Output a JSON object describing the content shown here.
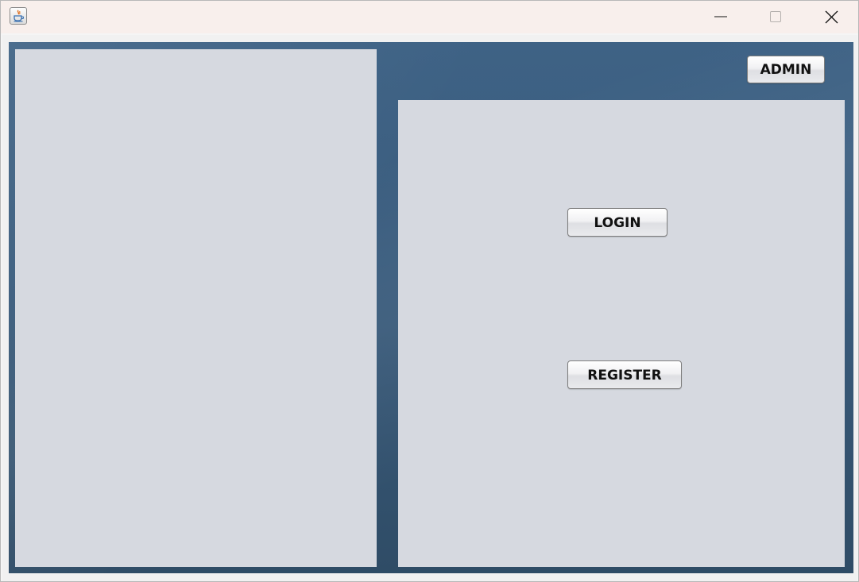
{
  "titlebar": {
    "app_icon": "java-icon",
    "controls": {
      "minimize_icon": "minimize-icon",
      "maximize_icon": "maximize-icon",
      "close_icon": "close-icon"
    }
  },
  "header": {
    "admin_label": "ADMIN"
  },
  "auth_panel": {
    "login_label": "LOGIN",
    "register_label": "REGISTER"
  },
  "colors": {
    "titlebar_bg": "#f8efec",
    "frame_bg": "#3a5c7d",
    "panel_bg": "#d6d9e0"
  }
}
